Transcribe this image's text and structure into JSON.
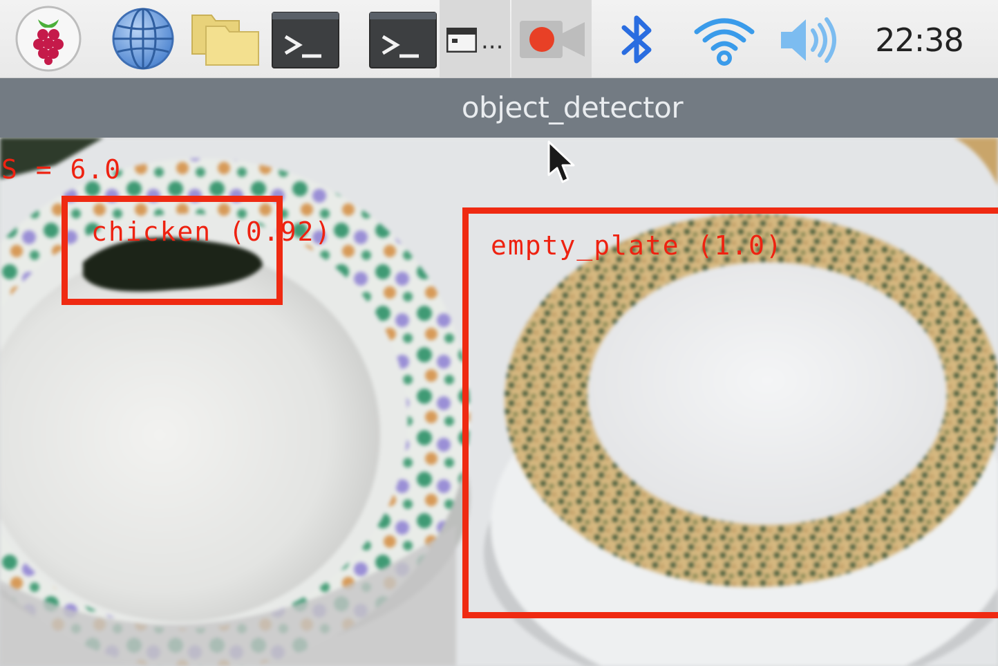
{
  "taskbar": {
    "launchers": [
      {
        "name": "raspberry-menu",
        "icon": "raspberry-icon"
      },
      {
        "name": "web-browser",
        "icon": "globe-icon"
      },
      {
        "name": "file-manager",
        "icon": "folder-icon"
      },
      {
        "name": "terminal",
        "icon": "terminal-icon"
      }
    ],
    "windows": [
      {
        "name": "terminal-window",
        "icon": "terminal-icon"
      },
      {
        "name": "window-list-item",
        "icon": "window-icon",
        "label": "..."
      },
      {
        "name": "camera-window",
        "icon": "camera-record-icon",
        "active": true
      }
    ],
    "tray": {
      "bluetooth": "bluetooth-icon",
      "wifi": "wifi-icon",
      "volume": "volume-icon"
    },
    "clock": "22:38"
  },
  "window": {
    "title": "object_detector"
  },
  "detections": {
    "fps_text": "S = 6.0",
    "items": [
      {
        "label_text": "chicken (0.92)"
      },
      {
        "label_text": "empty_plate (1.0)"
      }
    ]
  },
  "colors": {
    "bbox": "#ef2a12",
    "titlebar": "#737b83",
    "taskbar": "#efefef",
    "bluetooth": "#2a6de0",
    "wifi": "#3a9bea"
  }
}
